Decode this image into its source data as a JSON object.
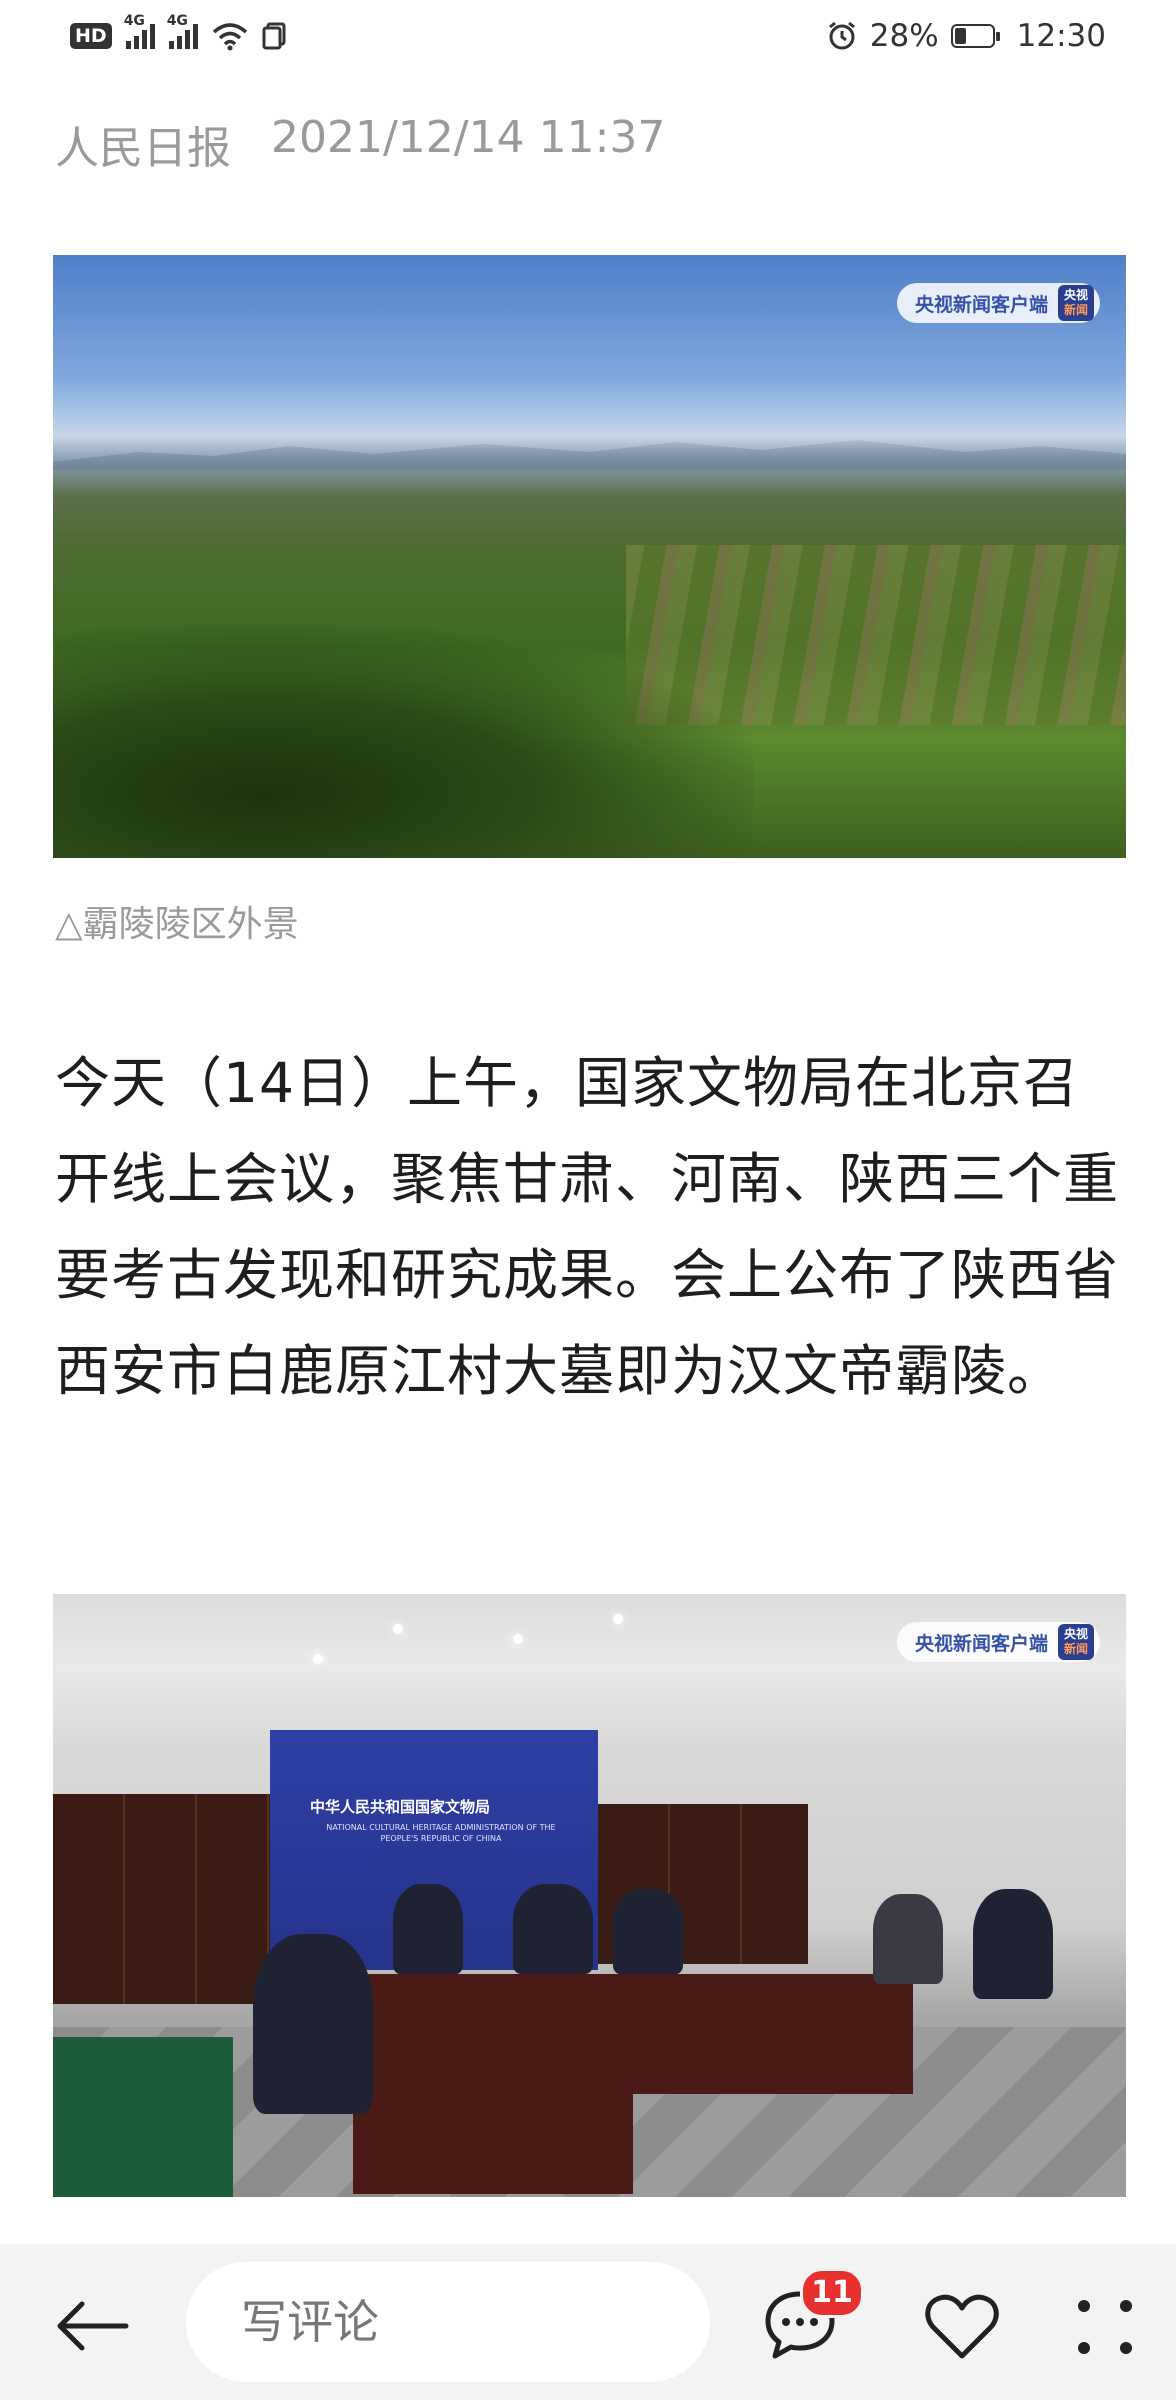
{
  "status_bar": {
    "hd": "HD",
    "net1": "4G",
    "net2": "4G",
    "battery_percent": "28%",
    "battery_level": 0.28,
    "time": "12:30"
  },
  "article": {
    "source": "人民日报",
    "datetime": "2021/12/14 11:37",
    "image1_caption": "△霸陵陵区外景",
    "watermark": "央视新闻客户端",
    "watermark_logo_top": "央视",
    "watermark_logo_bottom": "新闻",
    "body": "今天（14日）上午，国家文物局在北京召开线上会议，聚焦甘肃、河南、陕西三个重要考古发现和研究成果。会上公布了陕西省西安市白鹿原江村大墓即为汉文帝霸陵。",
    "image2_banner_cn": "中华人民共和国国家文物局",
    "image2_banner_en": "NATIONAL CULTURAL HERITAGE ADMINISTRATION OF THE PEOPLE'S REPUBLIC OF CHINA"
  },
  "bottom_bar": {
    "comment_placeholder": "写评论",
    "comment_count": "11",
    "icons": [
      "back-arrow-icon",
      "comments-icon",
      "heart-icon",
      "more-dots-icon"
    ]
  }
}
